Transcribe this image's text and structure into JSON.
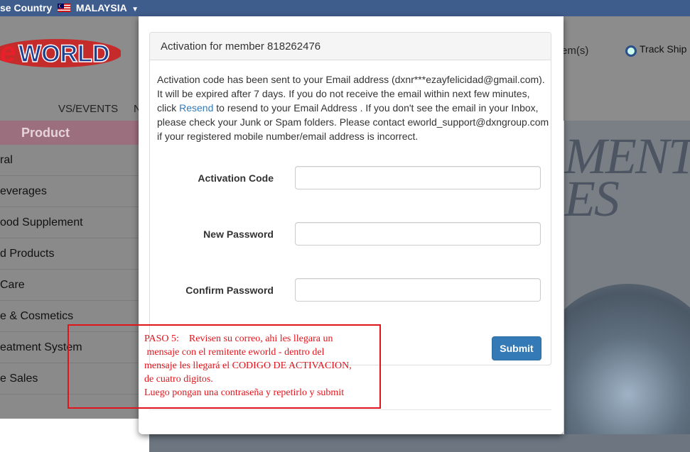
{
  "topbar": {
    "country_label": "se Country",
    "country_value": "MALAYSIA"
  },
  "header": {
    "logo_text": "eWORLD",
    "nav_partial": "VS/EVENTS",
    "nav_partial2": "N",
    "items_partial": "em(s)",
    "track_label": "Track Ship"
  },
  "sidebar": {
    "heading": "Product",
    "items": [
      {
        "label": "ral"
      },
      {
        "label": "everages"
      },
      {
        "label": "ood Supplement"
      },
      {
        "label": "d Products"
      },
      {
        "label": "Care"
      },
      {
        "label": "e & Cosmetics"
      },
      {
        "label": "eatment System"
      },
      {
        "label": "e Sales"
      }
    ]
  },
  "banner": {
    "text_line1": "MENT",
    "text_line2": "ES"
  },
  "modal": {
    "title": "Activation for member 818262476",
    "message_before_link": "Activation code has been sent to your Email address (dxnr***ezayfelicidad@gmail.com). It will be expired after 7 days. If you do not receive the email within next few minutes, click ",
    "link_text": "Resend",
    "message_after_link": " to resend to your Email Address . If you don't see the email in your Inbox, please check your Junk or Spam folders. Please contact eworld_support@dxngroup.com if your registered mobile number/email address is incorrect.",
    "fields": {
      "activation_code_label": "Activation Code",
      "new_password_label": "New Password",
      "confirm_password_label": "Confirm Password",
      "activation_code_value": "",
      "new_password_value": "",
      "confirm_password_value": ""
    },
    "submit_label": "Submit"
  },
  "annotation": {
    "text": "PASO 5:    Revisen su correo, ahi les llegara un\n mensaje con el remitente eworld - dentro del\nmensaje les llegará el CODIGO DE ACTIVACION,\nde cuatro digitos.\nLuego pongan una contraseña y repetirlo y submit",
    "color": "#e1141c"
  },
  "colors": {
    "topbar": "#3f5d8c",
    "primary_button": "#337ab7",
    "link": "#337ab7"
  }
}
